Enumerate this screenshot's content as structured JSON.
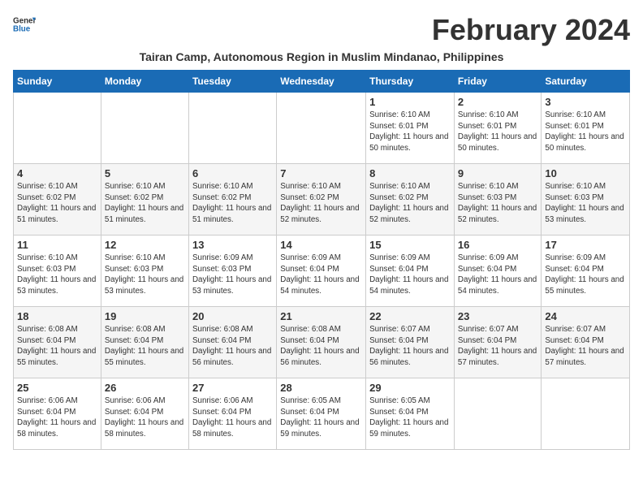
{
  "header": {
    "logo_line1": "General",
    "logo_line2": "Blue",
    "month_year": "February 2024",
    "subtitle": "Tairan Camp, Autonomous Region in Muslim Mindanao, Philippines"
  },
  "days_of_week": [
    "Sunday",
    "Monday",
    "Tuesday",
    "Wednesday",
    "Thursday",
    "Friday",
    "Saturday"
  ],
  "weeks": [
    [
      {
        "num": "",
        "info": ""
      },
      {
        "num": "",
        "info": ""
      },
      {
        "num": "",
        "info": ""
      },
      {
        "num": "",
        "info": ""
      },
      {
        "num": "1",
        "info": "Sunrise: 6:10 AM\nSunset: 6:01 PM\nDaylight: 11 hours and 50 minutes."
      },
      {
        "num": "2",
        "info": "Sunrise: 6:10 AM\nSunset: 6:01 PM\nDaylight: 11 hours and 50 minutes."
      },
      {
        "num": "3",
        "info": "Sunrise: 6:10 AM\nSunset: 6:01 PM\nDaylight: 11 hours and 50 minutes."
      }
    ],
    [
      {
        "num": "4",
        "info": "Sunrise: 6:10 AM\nSunset: 6:02 PM\nDaylight: 11 hours and 51 minutes."
      },
      {
        "num": "5",
        "info": "Sunrise: 6:10 AM\nSunset: 6:02 PM\nDaylight: 11 hours and 51 minutes."
      },
      {
        "num": "6",
        "info": "Sunrise: 6:10 AM\nSunset: 6:02 PM\nDaylight: 11 hours and 51 minutes."
      },
      {
        "num": "7",
        "info": "Sunrise: 6:10 AM\nSunset: 6:02 PM\nDaylight: 11 hours and 52 minutes."
      },
      {
        "num": "8",
        "info": "Sunrise: 6:10 AM\nSunset: 6:02 PM\nDaylight: 11 hours and 52 minutes."
      },
      {
        "num": "9",
        "info": "Sunrise: 6:10 AM\nSunset: 6:03 PM\nDaylight: 11 hours and 52 minutes."
      },
      {
        "num": "10",
        "info": "Sunrise: 6:10 AM\nSunset: 6:03 PM\nDaylight: 11 hours and 53 minutes."
      }
    ],
    [
      {
        "num": "11",
        "info": "Sunrise: 6:10 AM\nSunset: 6:03 PM\nDaylight: 11 hours and 53 minutes."
      },
      {
        "num": "12",
        "info": "Sunrise: 6:10 AM\nSunset: 6:03 PM\nDaylight: 11 hours and 53 minutes."
      },
      {
        "num": "13",
        "info": "Sunrise: 6:09 AM\nSunset: 6:03 PM\nDaylight: 11 hours and 53 minutes."
      },
      {
        "num": "14",
        "info": "Sunrise: 6:09 AM\nSunset: 6:04 PM\nDaylight: 11 hours and 54 minutes."
      },
      {
        "num": "15",
        "info": "Sunrise: 6:09 AM\nSunset: 6:04 PM\nDaylight: 11 hours and 54 minutes."
      },
      {
        "num": "16",
        "info": "Sunrise: 6:09 AM\nSunset: 6:04 PM\nDaylight: 11 hours and 54 minutes."
      },
      {
        "num": "17",
        "info": "Sunrise: 6:09 AM\nSunset: 6:04 PM\nDaylight: 11 hours and 55 minutes."
      }
    ],
    [
      {
        "num": "18",
        "info": "Sunrise: 6:08 AM\nSunset: 6:04 PM\nDaylight: 11 hours and 55 minutes."
      },
      {
        "num": "19",
        "info": "Sunrise: 6:08 AM\nSunset: 6:04 PM\nDaylight: 11 hours and 55 minutes."
      },
      {
        "num": "20",
        "info": "Sunrise: 6:08 AM\nSunset: 6:04 PM\nDaylight: 11 hours and 56 minutes."
      },
      {
        "num": "21",
        "info": "Sunrise: 6:08 AM\nSunset: 6:04 PM\nDaylight: 11 hours and 56 minutes."
      },
      {
        "num": "22",
        "info": "Sunrise: 6:07 AM\nSunset: 6:04 PM\nDaylight: 11 hours and 56 minutes."
      },
      {
        "num": "23",
        "info": "Sunrise: 6:07 AM\nSunset: 6:04 PM\nDaylight: 11 hours and 57 minutes."
      },
      {
        "num": "24",
        "info": "Sunrise: 6:07 AM\nSunset: 6:04 PM\nDaylight: 11 hours and 57 minutes."
      }
    ],
    [
      {
        "num": "25",
        "info": "Sunrise: 6:06 AM\nSunset: 6:04 PM\nDaylight: 11 hours and 58 minutes."
      },
      {
        "num": "26",
        "info": "Sunrise: 6:06 AM\nSunset: 6:04 PM\nDaylight: 11 hours and 58 minutes."
      },
      {
        "num": "27",
        "info": "Sunrise: 6:06 AM\nSunset: 6:04 PM\nDaylight: 11 hours and 58 minutes."
      },
      {
        "num": "28",
        "info": "Sunrise: 6:05 AM\nSunset: 6:04 PM\nDaylight: 11 hours and 59 minutes."
      },
      {
        "num": "29",
        "info": "Sunrise: 6:05 AM\nSunset: 6:04 PM\nDaylight: 11 hours and 59 minutes."
      },
      {
        "num": "",
        "info": ""
      },
      {
        "num": "",
        "info": ""
      }
    ]
  ]
}
